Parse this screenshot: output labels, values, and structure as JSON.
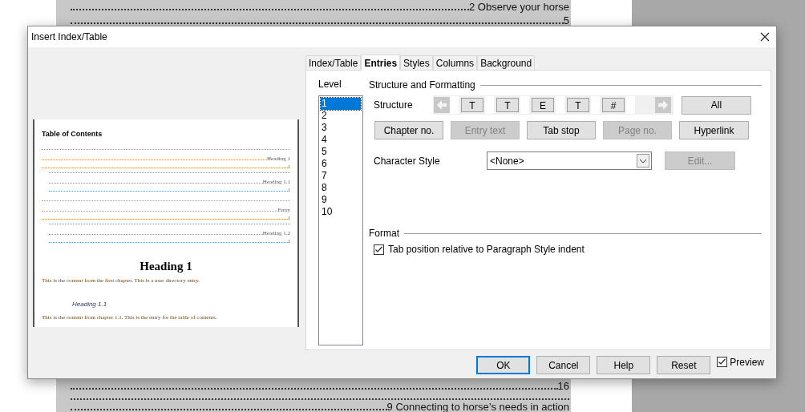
{
  "document": {
    "lines_top": [
      {
        "kind": "entry",
        "text": "2 Observe your horse"
      },
      {
        "kind": "entry",
        "text": "5"
      }
    ],
    "lines_bottom": [
      {
        "kind": "entry",
        "text": "16"
      },
      {
        "kind": "leader"
      },
      {
        "kind": "entry",
        "text": "9 Connecting to horse’s needs in action"
      }
    ]
  },
  "dialog": {
    "title": "Insert Index/Table",
    "preview": {
      "title": "Table of Contents",
      "entries": [
        {
          "text": "Heading 1",
          "page": "1",
          "color": "#f08c28",
          "children": [
            {
              "text": "Heading 1.1",
              "page": "1",
              "color": "#5a9ae6"
            }
          ]
        },
        {
          "text": "Entry",
          "page": "1",
          "color": "#f08c28",
          "children": [
            {
              "text": "Heading 1.2",
              "page": "1",
              "color": "#5a9ae6"
            }
          ]
        }
      ],
      "heading": "Heading 1",
      "paragraph_1": "This is the content from the first chapter. This is a user directory entry.",
      "subheading": "Heading 1.1",
      "paragraph_2": "This is the content from chapter 1.1. This is the entry for the table of contents."
    },
    "tabs": [
      {
        "label": "Index/Table",
        "selected": false
      },
      {
        "label": "Entries",
        "selected": true
      },
      {
        "label": "Styles",
        "selected": false
      },
      {
        "label": "Columns",
        "selected": false
      },
      {
        "label": "Background",
        "selected": false
      }
    ],
    "level": {
      "label": "Level",
      "items": [
        {
          "label": "1",
          "selected": true
        },
        {
          "label": "2",
          "selected": false
        },
        {
          "label": "3",
          "selected": false
        },
        {
          "label": "4",
          "selected": false
        },
        {
          "label": "5",
          "selected": false
        },
        {
          "label": "6",
          "selected": false
        },
        {
          "label": "7",
          "selected": false
        },
        {
          "label": "8",
          "selected": false
        },
        {
          "label": "9",
          "selected": false
        },
        {
          "label": "10",
          "selected": false
        }
      ]
    },
    "structure_and_formatting": {
      "heading": "Structure and Formatting",
      "structure_label": "Structure",
      "tokens": [
        "T",
        "T",
        "E",
        "T",
        "#"
      ],
      "all_button": "All",
      "buttons": [
        {
          "label": "Chapter no.",
          "disabled": false
        },
        {
          "label": "Entry text",
          "disabled": true
        },
        {
          "label": "Tab stop",
          "disabled": false
        },
        {
          "label": "Page no.",
          "disabled": true
        },
        {
          "label": "Hyperlink",
          "disabled": false
        }
      ],
      "character_style": {
        "label": "Character Style",
        "value": "<None>"
      },
      "edit_button": {
        "label": "Edit...",
        "disabled": true
      }
    },
    "format": {
      "heading": "Format",
      "option": {
        "label": "Tab position relative to Paragraph Style indent",
        "checked": true
      }
    },
    "footer": {
      "buttons": [
        {
          "label": "OK",
          "default": true
        },
        {
          "label": "Cancel",
          "default": false
        },
        {
          "label": "Help",
          "default": false
        },
        {
          "label": "Reset",
          "default": false
        }
      ],
      "preview_checkbox": {
        "label": "Preview",
        "checked": true
      }
    }
  }
}
